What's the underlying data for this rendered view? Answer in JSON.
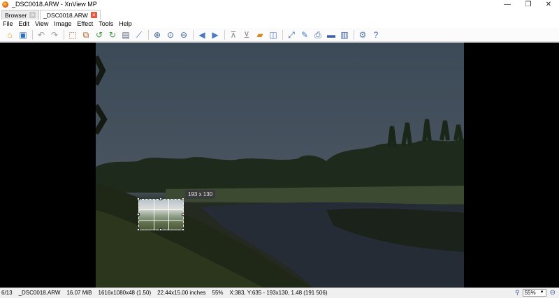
{
  "window": {
    "title": "_DSC0018.ARW - XnView MP"
  },
  "tabs": [
    {
      "label": "Browser",
      "active": false
    },
    {
      "label": "_DSC0018.ARW",
      "active": true
    }
  ],
  "menu": [
    "File",
    "Edit",
    "View",
    "Image",
    "Effect",
    "Tools",
    "Help"
  ],
  "toolbar": [
    {
      "name": "browser-icon",
      "glyph": "⌂",
      "color": "#d9a21b"
    },
    {
      "name": "save-icon",
      "glyph": "▣",
      "color": "#2e6fbf"
    },
    {
      "name": "undo-icon",
      "glyph": "↶",
      "color": "#9b9b9b"
    },
    {
      "name": "redo-icon",
      "glyph": "↷",
      "color": "#9b9b9b"
    },
    {
      "name": "crop-icon",
      "glyph": "⬚",
      "color": "#b35a1f"
    },
    {
      "name": "resize-icon",
      "glyph": "⧉",
      "color": "#b35a1f"
    },
    {
      "name": "rotate-left-icon",
      "glyph": "↺",
      "color": "#3d9a3d"
    },
    {
      "name": "rotate-right-icon",
      "glyph": "↻",
      "color": "#3d9a3d"
    },
    {
      "name": "adjust-icon",
      "glyph": "▤",
      "color": "#5b6a7a"
    },
    {
      "name": "histogram-icon",
      "glyph": "⟋",
      "color": "#4273b2"
    },
    {
      "name": "zoom-in-icon",
      "glyph": "⊕",
      "color": "#3a5f9e"
    },
    {
      "name": "zoom-fit-icon",
      "glyph": "⊙",
      "color": "#3a5f9e"
    },
    {
      "name": "zoom-out-icon",
      "glyph": "⊖",
      "color": "#3a5f9e"
    },
    {
      "name": "previous-icon",
      "glyph": "◀",
      "color": "#4a78c4"
    },
    {
      "name": "next-icon",
      "glyph": "▶",
      "color": "#4a78c4"
    },
    {
      "name": "first-icon",
      "glyph": "⊼",
      "color": "#8a8a8a"
    },
    {
      "name": "last-icon",
      "glyph": "⊻",
      "color": "#8a8a8a"
    },
    {
      "name": "slideshow-icon",
      "glyph": "▰",
      "color": "#d98a1e"
    },
    {
      "name": "compare-icon",
      "glyph": "◫",
      "color": "#4a78c4"
    },
    {
      "name": "fullscreen-icon",
      "glyph": "⤢",
      "color": "#3a5f9e"
    },
    {
      "name": "edit-icon",
      "glyph": "✎",
      "color": "#4a78c4"
    },
    {
      "name": "print-icon",
      "glyph": "⎙",
      "color": "#3a5f9e"
    },
    {
      "name": "scanner-icon",
      "glyph": "▬",
      "color": "#3a5f9e"
    },
    {
      "name": "wallpaper-icon",
      "glyph": "▥",
      "color": "#3a5f9e"
    },
    {
      "name": "settings-icon",
      "glyph": "⚙",
      "color": "#5a7ab0"
    },
    {
      "name": "help-icon",
      "glyph": "?",
      "color": "#4a5fc4"
    }
  ],
  "crop": {
    "size_label": "193 x 130"
  },
  "status": {
    "index": "6/13",
    "filename": "_DSC0018.ARW",
    "filesize": "16.07 MiB",
    "dimensions": "1616x1080x48 (1.50)",
    "print_size": "22.44x15.00 inches",
    "zoom": "55%",
    "coords": "X:383, Y:635 - 193x130, 1.48 (191 506)"
  },
  "zoom_control": {
    "value": "55%"
  },
  "colors": {
    "tab_close_active": "#e8563d",
    "viewer_bg": "#000000"
  }
}
